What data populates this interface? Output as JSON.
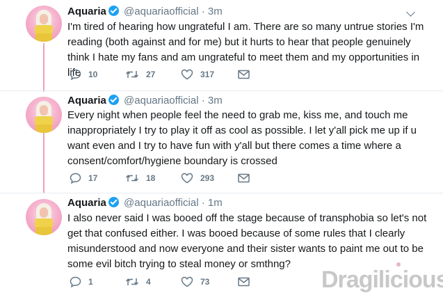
{
  "tweets": [
    {
      "name": "Aquaria",
      "handle": "@aquariaofficial",
      "separator": "·",
      "time": "3m",
      "text": "I'm tired of hearing how ungrateful I am. There are so many untrue stories I'm reading (both against and for me) but it hurts to hear that people genuinely think I hate my fans and am ungrateful to meet them and my opportunities in life",
      "replies": "10",
      "retweets": "27",
      "likes": "317"
    },
    {
      "name": "Aquaria",
      "handle": "@aquariaofficial",
      "separator": "·",
      "time": "3m",
      "text": "Every night when people feel the need to grab me, kiss me, and touch me inappropriately I try to play it off as cool as possible. I let y'all pick me up if u want even and I try to have fun with y'all but there comes a time where a consent/comfort/hygiene boundary is crossed",
      "replies": "17",
      "retweets": "18",
      "likes": "293"
    },
    {
      "name": "Aquaria",
      "handle": "@aquariaofficial",
      "separator": "·",
      "time": "1m",
      "text": "I also never said I was booed off the stage because of transphobia so let's not get that confused either. I was booed because of some rules that I clearly misunderstood and now everyone and their sister wants to paint me out to be some evil bitch trying to steal money or smthng?",
      "replies": "1",
      "retweets": "4",
      "likes": "73"
    }
  ],
  "watermark": "Dragilicious",
  "colors": {
    "verified": "#1da1f2",
    "muted": "#657786",
    "thread_line": "#f0a0c0"
  },
  "icons": [
    "reply-icon",
    "retweet-icon",
    "like-icon",
    "message-icon",
    "verified-icon",
    "chevron-down-icon"
  ]
}
